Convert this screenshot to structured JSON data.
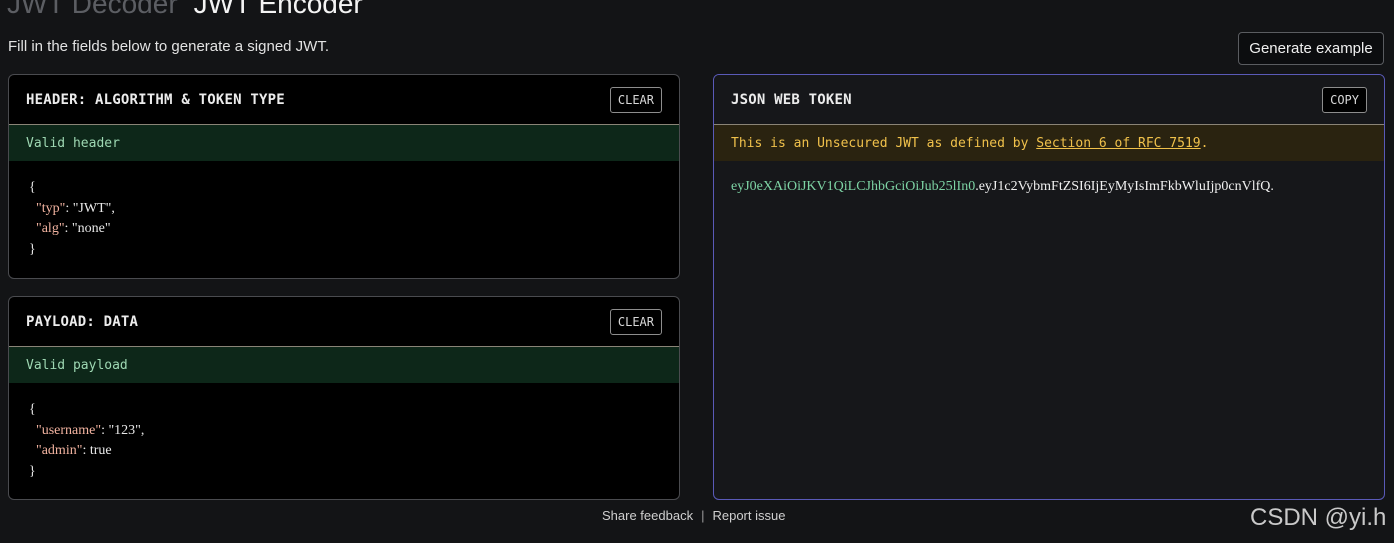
{
  "tabs": [
    {
      "label": "JWT Decoder",
      "active": false
    },
    {
      "label": "JWT Encoder",
      "active": true
    }
  ],
  "subtitle": "Fill in the fields below to generate a signed JWT.",
  "generate_button": "Generate example",
  "header_panel": {
    "title": "HEADER: ALGORITHM & TOKEN TYPE",
    "clear_label": "CLEAR",
    "status": "Valid header",
    "code": {
      "open": "{",
      "lines": [
        {
          "key": "\"typ\"",
          "rest": ": \"JWT\","
        },
        {
          "key": "\"alg\"",
          "rest": ": \"none\""
        }
      ],
      "close": "}"
    }
  },
  "payload_panel": {
    "title": "PAYLOAD: DATA",
    "clear_label": "CLEAR",
    "status": "Valid payload",
    "code": {
      "open": "{",
      "lines": [
        {
          "key": "\"username\"",
          "rest": ": \"123\","
        },
        {
          "key": "\"admin\"",
          "rest": ": true"
        }
      ],
      "close": "}"
    }
  },
  "token_panel": {
    "title": "JSON WEB TOKEN",
    "copy_label": "COPY",
    "warning_prefix": "This is an Unsecured JWT as defined by ",
    "warning_link": "Section 6 of RFC 7519",
    "warning_suffix": ".",
    "token_header": "eyJ0eXAiOiJKV1QiLCJhbGciOiJub25lIn0",
    "token_dot1": ".",
    "token_payload": "eyJ1c2VybmFtZSI6IjEyMyIsImFkbWluIjp0cnVlfQ",
    "token_dot2": "."
  },
  "footer": {
    "share_feedback": "Share feedback",
    "separator": "|",
    "report_issue": "Report issue"
  },
  "watermark": "CSDN @yi.h",
  "colors": {
    "background": "#131416",
    "valid_bg": "#0d2719",
    "valid_text": "#9ed8b3",
    "warn_bg": "#2a2310",
    "warn_text": "#f0c14b",
    "token_header": "#7dd3a4",
    "json_key": "#f2b3a0",
    "token_panel_border": "#5a5ab8"
  }
}
